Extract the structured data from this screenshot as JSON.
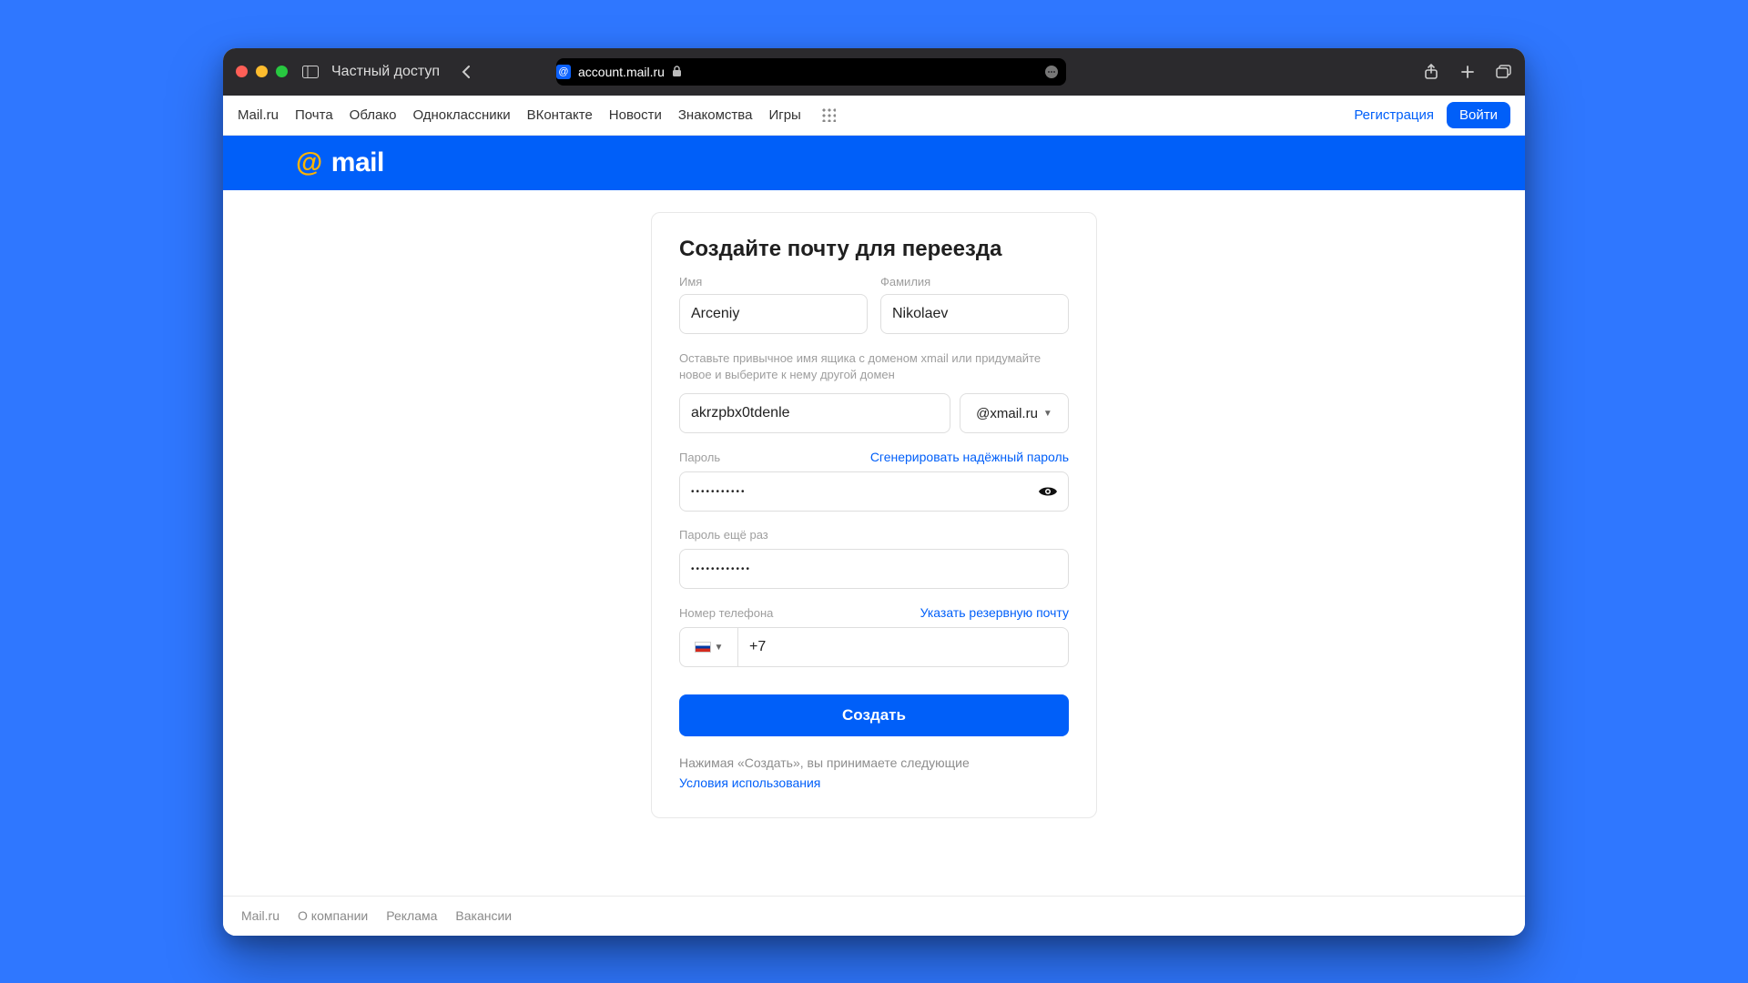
{
  "browser": {
    "private_mode": "Частный доступ",
    "url": "account.mail.ru"
  },
  "topnav": {
    "links": [
      "Mail.ru",
      "Почта",
      "Облако",
      "Одноклассники",
      "ВКонтакте",
      "Новости",
      "Знакомства",
      "Игры"
    ],
    "register": "Регистрация",
    "login": "Войти"
  },
  "brand": {
    "at": "@",
    "word": "mail"
  },
  "form": {
    "title": "Создайте почту для переезда",
    "first_name": {
      "label": "Имя",
      "value": "Arceniy"
    },
    "last_name": {
      "label": "Фамилия",
      "value": "Nikolaev"
    },
    "email_hint": "Оставьте привычное имя ящика с доменом xmail или придумайте новое и выберите к нему другой домен",
    "email": {
      "value": "akrzpbx0tdenle"
    },
    "domain": {
      "selected": "@xmail.ru"
    },
    "password": {
      "label": "Пароль",
      "generate_link": "Сгенерировать надёжный пароль",
      "value": "•••••••••••"
    },
    "password2": {
      "label": "Пароль ещё раз",
      "value": "••••••••••••"
    },
    "phone": {
      "label": "Номер телефона",
      "backup_link": "Указать резервную почту",
      "prefix": "+7"
    },
    "submit": "Создать",
    "tos_text": "Нажимая «Создать», вы принимаете следующие",
    "tos_link": "Условия использования"
  },
  "footer": {
    "items": [
      "Mail.ru",
      "О компании",
      "Реклама",
      "Вакансии"
    ]
  }
}
